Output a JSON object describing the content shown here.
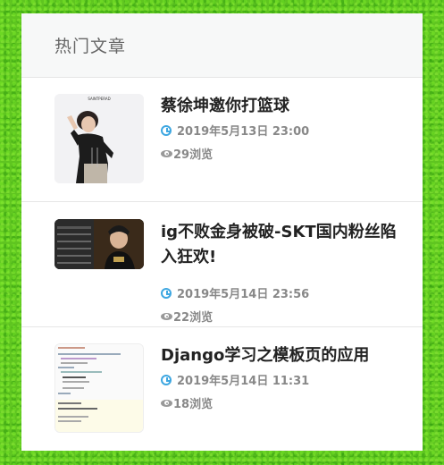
{
  "panel": {
    "title": "热门文章"
  },
  "articles": [
    {
      "title": "蔡徐坤邀你打篮球",
      "date": "2019年5月13日 23:00",
      "views": "29浏览",
      "thumb_caption": "SAINTPERAD"
    },
    {
      "title": "ig不败金身被破-SKT国内粉丝陷入狂欢!",
      "date": "2019年5月14日 23:56",
      "views": "22浏览"
    },
    {
      "title": "Django学习之模板页的应用",
      "date": "2019年5月14日 11:31",
      "views": "18浏览"
    }
  ],
  "colors": {
    "clock": "#3ea7e1",
    "background": "#5fc520"
  }
}
